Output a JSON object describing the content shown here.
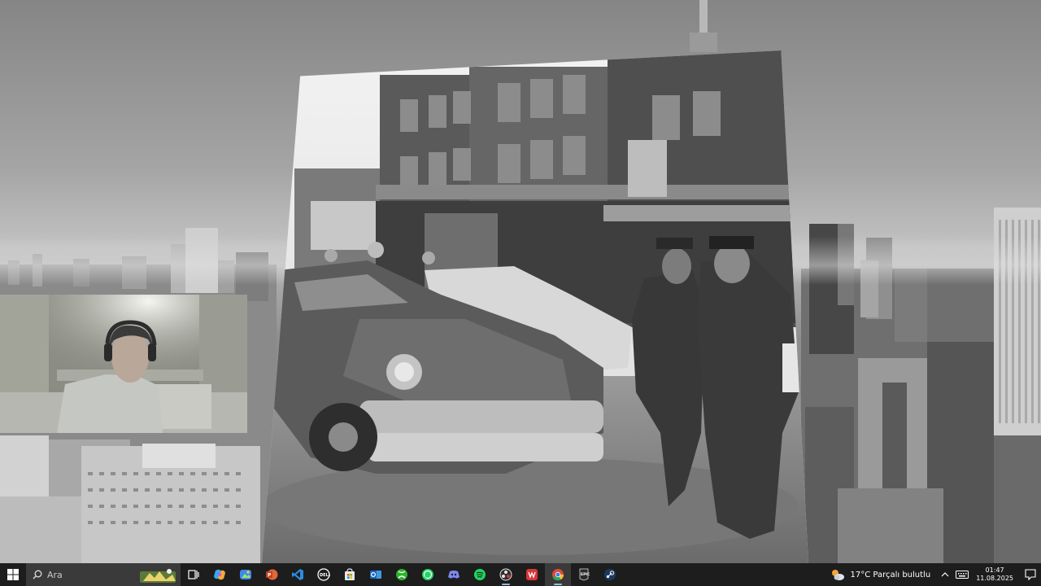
{
  "taskbar": {
    "search_placeholder": "Ara",
    "apps": [
      {
        "name": "task-view"
      },
      {
        "name": "copilot"
      },
      {
        "name": "photos"
      },
      {
        "name": "powerpoint"
      },
      {
        "name": "vscode"
      },
      {
        "name": "dell"
      },
      {
        "name": "microsoft-store"
      },
      {
        "name": "outlook"
      },
      {
        "name": "xbox"
      },
      {
        "name": "whatsapp"
      },
      {
        "name": "discord"
      },
      {
        "name": "spotify"
      },
      {
        "name": "obs"
      },
      {
        "name": "app-red"
      },
      {
        "name": "chrome"
      },
      {
        "name": "epic-games"
      },
      {
        "name": "steam"
      }
    ],
    "weather": {
      "temp": "17°C",
      "condition": "Parçalı bulutlu"
    },
    "clock": {
      "time": "01:47",
      "date": "11.08.2025"
    }
  },
  "colors": {
    "taskbar_bg": "#1d1d1d",
    "search_bg": "#3a3a3a"
  }
}
